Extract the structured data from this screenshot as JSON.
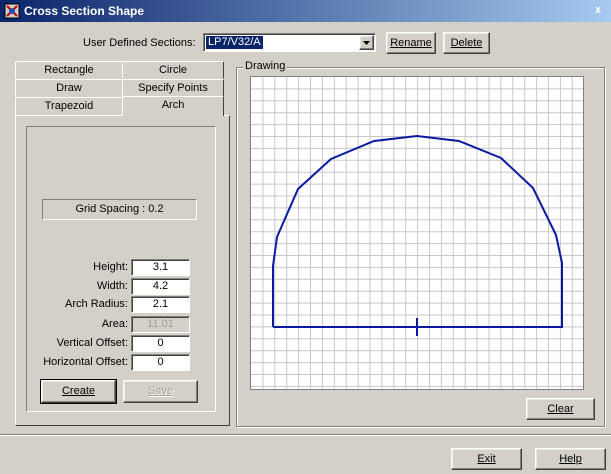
{
  "window": {
    "title": "Cross Section Shape",
    "close_glyph": "x"
  },
  "sections": {
    "label": "User Defined Sections:",
    "selected": "LP7/V32/A",
    "rename_label": "Rename",
    "delete_label": "Delete"
  },
  "tabs": {
    "row1": [
      "Rectangle",
      "Circle"
    ],
    "row2": [
      "Draw",
      "Specify Points"
    ],
    "row3": [
      "Trapezoid",
      "Arch"
    ],
    "active": "Arch"
  },
  "arch_panel": {
    "grid_spacing": "Grid Spacing : 0.2",
    "fields": [
      {
        "label": "Height:",
        "value": "3.1",
        "enabled": true
      },
      {
        "label": "Width:",
        "value": "4.2",
        "enabled": true
      },
      {
        "label": "Arch Radius:",
        "value": "2.1",
        "enabled": true
      },
      {
        "label": "Area:",
        "value": "11.01",
        "enabled": false
      },
      {
        "label": "Vertical Offset:",
        "value": "0",
        "enabled": true
      },
      {
        "label": "Horizontal Offset:",
        "value": "0",
        "enabled": true
      }
    ],
    "create_label": "Create",
    "save_label": "Save"
  },
  "drawing": {
    "group_title": "Drawing",
    "clear_label": "Clear",
    "shape_color": "#0a1aa0",
    "grid_color": "#c8c8c8"
  },
  "footer": {
    "exit_label": "Exit",
    "help_label": "Help"
  }
}
